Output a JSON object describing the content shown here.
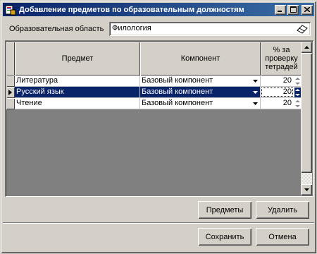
{
  "window": {
    "title": "Добавление предметов по образовательным должностям"
  },
  "area": {
    "label": "Образовательная область",
    "value": "Филология"
  },
  "grid": {
    "headers": {
      "subject": "Предмет",
      "component": "Компонент",
      "percent_l1": "% за",
      "percent_l2": "проверку",
      "percent_l3": "тетрадей"
    },
    "rows": [
      {
        "subject": "Литература",
        "component": "Базовый компонент",
        "percent": "20"
      },
      {
        "subject": "Русский язык",
        "component": "Базовый компонент",
        "percent": "20"
      },
      {
        "subject": "Чтение",
        "component": "Базовый компонент",
        "percent": "20"
      }
    ],
    "selected_row": 2
  },
  "buttons": {
    "subjects": "Предметы",
    "delete": "Удалить",
    "save": "Сохранить",
    "cancel": "Отмена"
  }
}
